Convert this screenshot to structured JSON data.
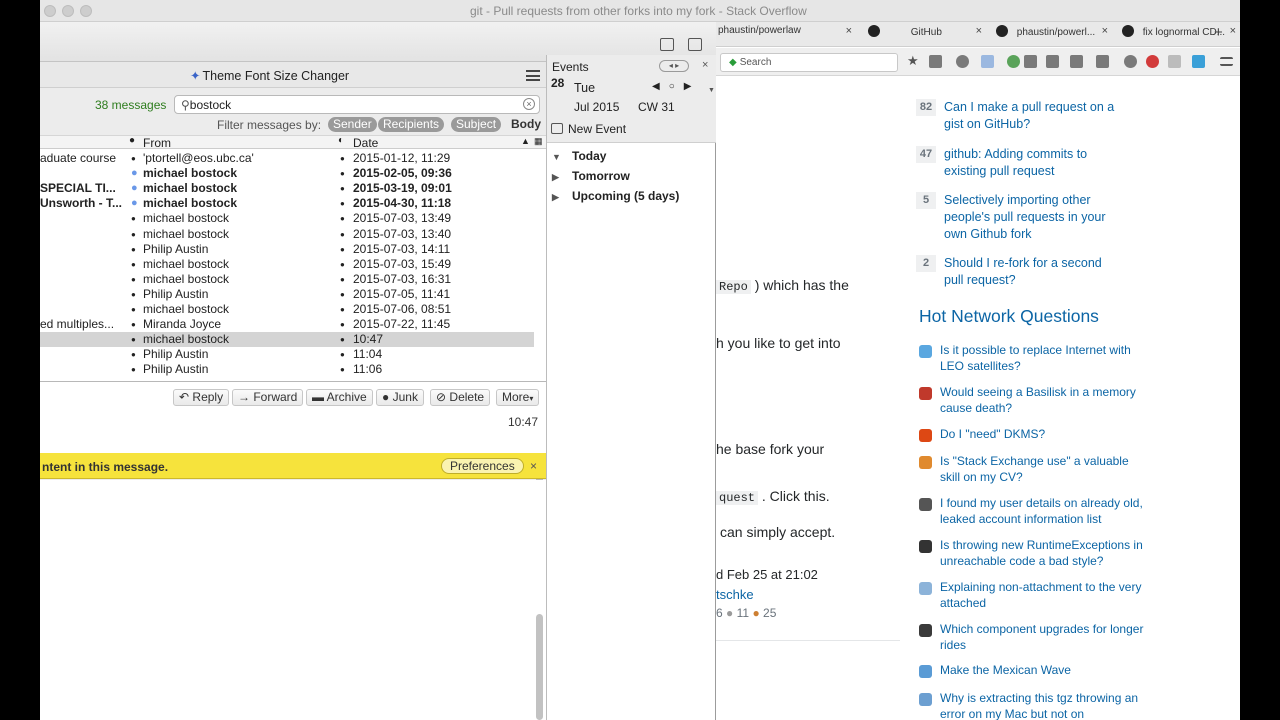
{
  "browser": {
    "window_title": "git - Pull requests from other forks into my fork - Stack Overflow",
    "tabs": [
      {
        "label": "phaustin/powerlaw",
        "close": "×"
      },
      {
        "label": "GitHub",
        "close": "×"
      },
      {
        "label": "phaustin/powerl...",
        "close": "×"
      },
      {
        "label": "fix lognormal CD...",
        "close": "×"
      }
    ],
    "new_tab": "+",
    "search_placeholder": "Search"
  },
  "stackoverflow": {
    "fragments": {
      "repo_code": "Repo",
      "repo_text": ") which has the",
      "line2": "h you like to get into",
      "line3": "he base fork your",
      "quest_code": "quest",
      "line4": ". Click this.",
      "line5": "can simply accept.",
      "asked": "d Feb 25 at 21:02",
      "user": "tschke",
      "rep_a": "6",
      "rep_b": "11",
      "rep_c": "25"
    },
    "linked": [
      {
        "votes": "82",
        "title": "Can I make a pull request on a gist on GitHub?"
      },
      {
        "votes": "47",
        "title": "github: Adding commits to existing pull request"
      },
      {
        "votes": "5",
        "title": "Selectively importing other people's pull requests in your own Github fork"
      },
      {
        "votes": "2",
        "title": "Should I re-fork for a second pull request?"
      }
    ],
    "hnq_title": "Hot Network Questions",
    "hnq": [
      {
        "title": "Is it possible to replace Internet with LEO satellites?",
        "color": "#5aa7e0"
      },
      {
        "title": "Would seeing a Basilisk in a memory cause death?",
        "color": "#c0392b"
      },
      {
        "title": "Do I \"need\" DKMS?",
        "color": "#dd4814"
      },
      {
        "title": "Is \"Stack Exchange use\" a valuable skill on my CV?",
        "color": "#e08a2e"
      },
      {
        "title": "I found my user details on already old, leaked account information list",
        "color": "#555555"
      },
      {
        "title": "Is throwing new RuntimeExceptions in unreachable code a bad style?",
        "color": "#333333"
      },
      {
        "title": "Explaining non-attachment to the very attached",
        "color": "#8cb3d9"
      },
      {
        "title": "Which component upgrades for longer rides",
        "color": "#3a3a3a"
      },
      {
        "title": "Make the Mexican Wave",
        "color": "#5a9bd5"
      },
      {
        "title": "Why is extracting this tgz throwing an error on my Mac but not on",
        "color": "#6c9fd1"
      }
    ]
  },
  "mail": {
    "theme_button": "Theme Font Size Changer",
    "message_count": "38 messages",
    "search_value": "bostock",
    "filter_label": "Filter messages by:",
    "filters": [
      "Sender",
      "Recipients",
      "Subject",
      "Body"
    ],
    "columns": {
      "from": "From",
      "date": "Date"
    },
    "rows": [
      {
        "subject": "aduate course",
        "from": "'ptortell@eos.ubc.ca'",
        "date": "2015-01-12, 11:29",
        "bold": false,
        "unread": false
      },
      {
        "subject": "",
        "from": "michael bostock",
        "date": "2015-02-05, 09:36",
        "bold": true,
        "unread": true
      },
      {
        "subject": "SPECIAL TI...",
        "from": "michael bostock",
        "date": "2015-03-19, 09:01",
        "bold": true,
        "unread": true
      },
      {
        "subject": "Unsworth - T...",
        "from": "michael bostock",
        "date": "2015-04-30, 11:18",
        "bold": true,
        "unread": true
      },
      {
        "subject": "",
        "from": "michael bostock",
        "date": "2015-07-03, 13:49",
        "bold": false,
        "unread": false
      },
      {
        "subject": "",
        "from": "michael bostock",
        "date": "2015-07-03, 13:40",
        "bold": false,
        "unread": false
      },
      {
        "subject": "",
        "from": "Philip Austin",
        "date": "2015-07-03, 14:11",
        "bold": false,
        "unread": false
      },
      {
        "subject": "",
        "from": "michael bostock",
        "date": "2015-07-03, 15:49",
        "bold": false,
        "unread": false
      },
      {
        "subject": "",
        "from": "michael bostock",
        "date": "2015-07-03, 16:31",
        "bold": false,
        "unread": false
      },
      {
        "subject": "",
        "from": "Philip Austin",
        "date": "2015-07-05, 11:41",
        "bold": false,
        "unread": false
      },
      {
        "subject": "",
        "from": "michael bostock",
        "date": "2015-07-06, 08:51",
        "bold": false,
        "unread": false
      },
      {
        "subject": "ed multiples...",
        "from": "Miranda Joyce",
        "date": "2015-07-22, 11:45",
        "bold": false,
        "unread": false
      },
      {
        "subject": "",
        "from": "michael bostock",
        "date": "10:47",
        "bold": false,
        "unread": false,
        "selected": true
      },
      {
        "subject": "",
        "from": "Philip Austin",
        "date": "11:04",
        "bold": false,
        "unread": false
      },
      {
        "subject": "",
        "from": "Philip Austin",
        "date": "11:06",
        "bold": false,
        "unread": false
      }
    ],
    "actions": {
      "reply": "Reply",
      "forward": "Forward",
      "archive": "Archive",
      "junk": "Junk",
      "delete": "Delete",
      "more": "More"
    },
    "message_time": "10:47",
    "notice": "ntent in this message.",
    "preferences": "Preferences"
  },
  "events": {
    "title": "Events",
    "day": "28",
    "weekday": "Tue",
    "month": "Jul 2015",
    "week": "CW 31",
    "new_event": "New Event",
    "groups": [
      "Today",
      "Tomorrow",
      "Upcoming (5 days)"
    ]
  }
}
